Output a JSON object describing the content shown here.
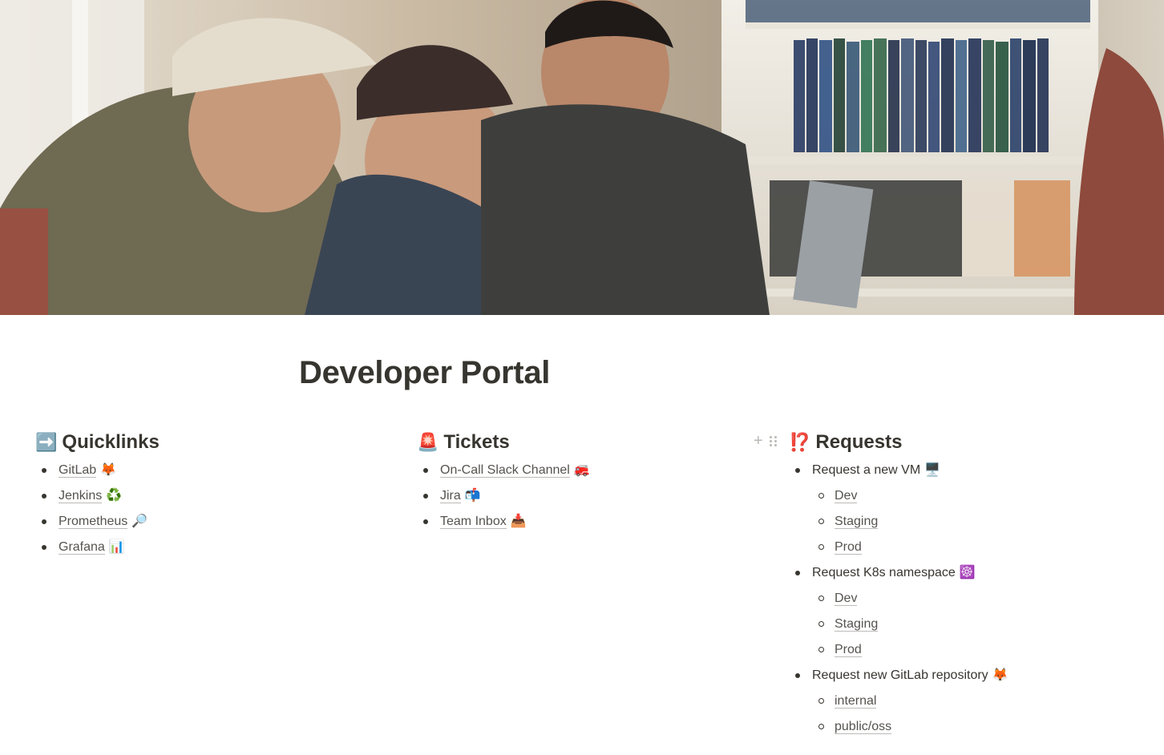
{
  "page": {
    "title": "Developer Portal"
  },
  "sections": {
    "quicklinks": {
      "emoji": "➡️",
      "title": "Quicklinks",
      "items": [
        {
          "label": "GitLab",
          "emoji": "🦊"
        },
        {
          "label": "Jenkins",
          "emoji": "♻️"
        },
        {
          "label": "Prometheus",
          "emoji": "🔎"
        },
        {
          "label": "Grafana",
          "emoji": "📊"
        }
      ]
    },
    "tickets": {
      "emoji": "🚨",
      "title": "Tickets",
      "items": [
        {
          "label": "On-Call Slack Channel",
          "emoji": "🚒"
        },
        {
          "label": "Jira",
          "emoji": "📬"
        },
        {
          "label": "Team Inbox",
          "emoji": "📥"
        }
      ]
    },
    "requests": {
      "emoji": "⁉️",
      "title": "Requests",
      "groups": [
        {
          "label": "Request a new VM",
          "emoji": "🖥️",
          "children": [
            "Dev",
            "Staging",
            "Prod"
          ]
        },
        {
          "label": "Request K8s namespace",
          "emoji": "☸️",
          "children": [
            "Dev",
            "Staging",
            "Prod"
          ]
        },
        {
          "label": "Request new GitLab repository",
          "emoji": "🦊",
          "children": [
            "internal",
            "public/oss"
          ]
        }
      ]
    }
  },
  "icons": {
    "block_add": "+",
    "block_drag": "drag-handle-icon"
  },
  "colors": {
    "text": "#37352f",
    "handle": "#b9b8b4"
  }
}
